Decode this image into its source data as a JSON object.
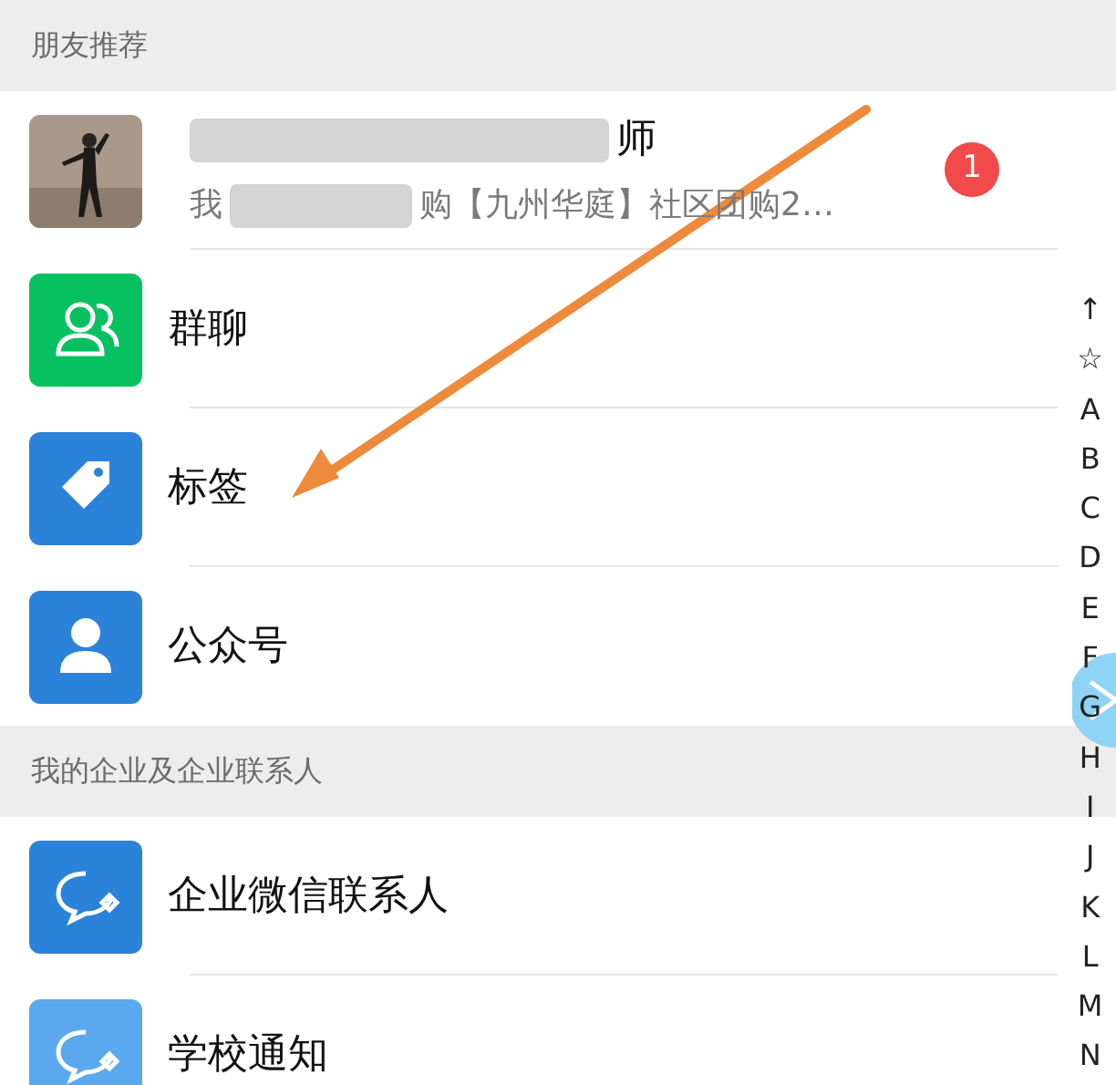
{
  "sections": [
    {
      "header": "朋友推荐",
      "items": [
        {
          "kind": "recommend",
          "name": "师",
          "subtitle_start": "我",
          "subtitle_end": "购【九州华庭】社区团购2…",
          "badge": "1"
        },
        {
          "kind": "group",
          "name": "群聊"
        },
        {
          "kind": "tag",
          "name": "标签"
        },
        {
          "kind": "official",
          "name": "公众号"
        }
      ]
    },
    {
      "header": "我的企业及企业联系人",
      "items": [
        {
          "kind": "wework",
          "name": "企业微信联系人"
        },
        {
          "kind": "school",
          "name": "学校通知"
        }
      ]
    }
  ],
  "index": [
    "↑",
    "☆",
    "A",
    "B",
    "C",
    "D",
    "E",
    "F",
    "G",
    "H",
    "I",
    "J",
    "K",
    "L",
    "M",
    "N"
  ]
}
